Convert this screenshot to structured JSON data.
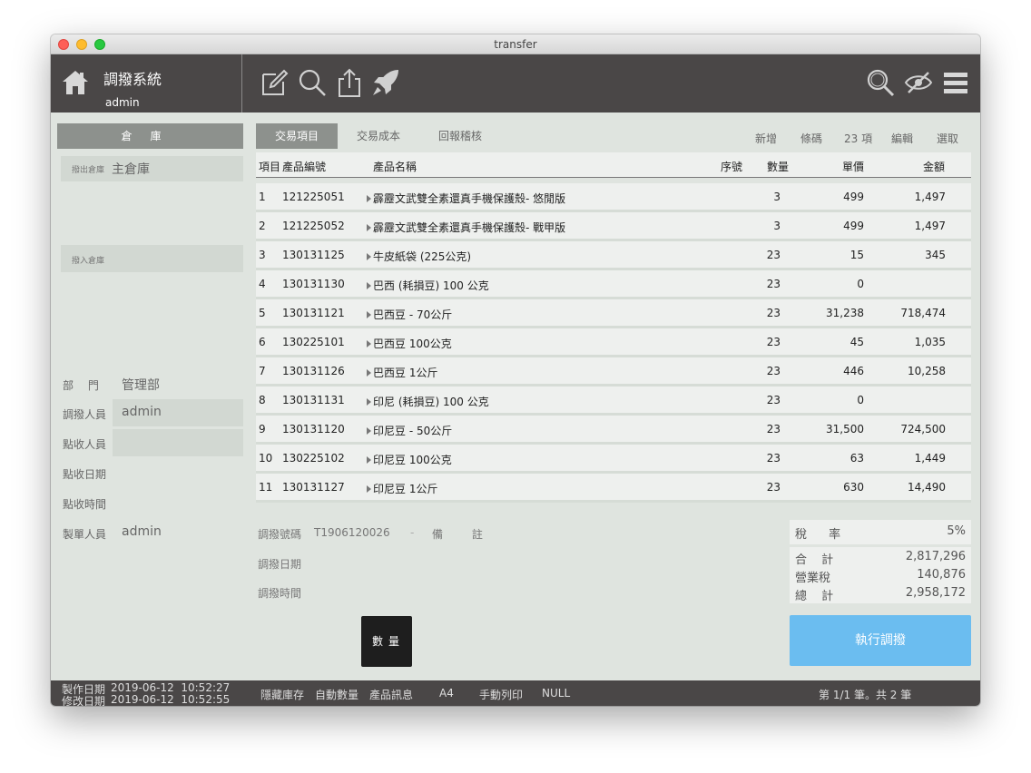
{
  "window": {
    "title": "transfer"
  },
  "header": {
    "app_title": "調撥系統",
    "user": "admin"
  },
  "toolbar_icons": [
    "edit-icon",
    "search-icon",
    "share-icon",
    "rocket-icon",
    "search-icon",
    "hide-icon",
    "menu-icon"
  ],
  "sidebar": {
    "warehouse_header": "倉庫",
    "out_label": "撥出倉庫",
    "out_value": "主倉庫",
    "in_label": "撥入倉庫",
    "department_label": "部 門",
    "department_value": "管理部",
    "transferer_label": "調撥人員",
    "transferer_value": "admin",
    "receiver_label": "點收人員",
    "receiver_value": "",
    "receive_date_label": "點收日期",
    "receive_time_label": "點收時間",
    "creator_label": "製單人員",
    "creator_value": "admin"
  },
  "tabs": [
    "交易項目",
    "交易成本",
    "回報稽核"
  ],
  "actions": {
    "add": "新增",
    "barcode": "條碼",
    "count": "23 項",
    "edit": "編輯",
    "select": "選取"
  },
  "table": {
    "headers": {
      "item": "項目",
      "code": "產品編號",
      "name": "產品名稱",
      "seq": "序號",
      "qty": "數量",
      "price": "單價",
      "amount": "金額"
    },
    "rows": [
      {
        "item": "1",
        "code": "121225051",
        "name": "霹靂文武雙全素還真手機保護殼- 悠閒版",
        "qty": "3",
        "price": "499",
        "amount": "1,497"
      },
      {
        "item": "2",
        "code": "121225052",
        "name": "霹靂文武雙全素還真手機保護殼- 戰甲版",
        "qty": "3",
        "price": "499",
        "amount": "1,497"
      },
      {
        "item": "3",
        "code": "130131125",
        "name": "牛皮紙袋 (225公克)",
        "qty": "23",
        "price": "15",
        "amount": "345"
      },
      {
        "item": "4",
        "code": "130131130",
        "name": "巴西 (耗損豆) 100 公克",
        "qty": "23",
        "price": "0",
        "amount": ""
      },
      {
        "item": "5",
        "code": "130131121",
        "name": "巴西豆 - 70公斤",
        "qty": "23",
        "price": "31,238",
        "amount": "718,474"
      },
      {
        "item": "6",
        "code": "130225101",
        "name": "巴西豆 100公克",
        "qty": "23",
        "price": "45",
        "amount": "1,035"
      },
      {
        "item": "7",
        "code": "130131126",
        "name": "巴西豆 1公斤",
        "qty": "23",
        "price": "446",
        "amount": "10,258"
      },
      {
        "item": "8",
        "code": "130131131",
        "name": "印尼 (耗損豆) 100 公克",
        "qty": "23",
        "price": "0",
        "amount": ""
      },
      {
        "item": "9",
        "code": "130131120",
        "name": "印尼豆 - 50公斤",
        "qty": "23",
        "price": "31,500",
        "amount": "724,500"
      },
      {
        "item": "10",
        "code": "130225102",
        "name": "印尼豆 100公克",
        "qty": "23",
        "price": "63",
        "amount": "1,449"
      },
      {
        "item": "11",
        "code": "130131127",
        "name": "印尼豆 1公斤",
        "qty": "23",
        "price": "630",
        "amount": "14,490"
      }
    ]
  },
  "meta": {
    "number_label": "調撥號碼",
    "number_value": "T1906120026",
    "dash": "-",
    "remark_label": "備 註",
    "date_label": "調撥日期",
    "time_label": "調撥時間"
  },
  "summary": {
    "tax_rate_label": "稅 率",
    "tax_rate_value": "5%",
    "subtotal_label": "合 計",
    "subtotal_value": "2,817,296",
    "tax_label": "營業稅",
    "tax_value": "140,876",
    "total_label": "總 計",
    "total_value": "2,958,172"
  },
  "buttons": {
    "quantity": "數量",
    "execute": "執行調撥"
  },
  "status": {
    "created_label": "製作日期",
    "created_value": "2019-06-12  10:52:27",
    "modified_label": "修改日期",
    "modified_value": "2019-06-12  10:52:55",
    "items": [
      "隱藏庫存",
      "自動數量",
      "產品訊息",
      "A4",
      "手動列印",
      "NULL"
    ],
    "page_info": "第 1/1 筆。共 2 筆"
  }
}
